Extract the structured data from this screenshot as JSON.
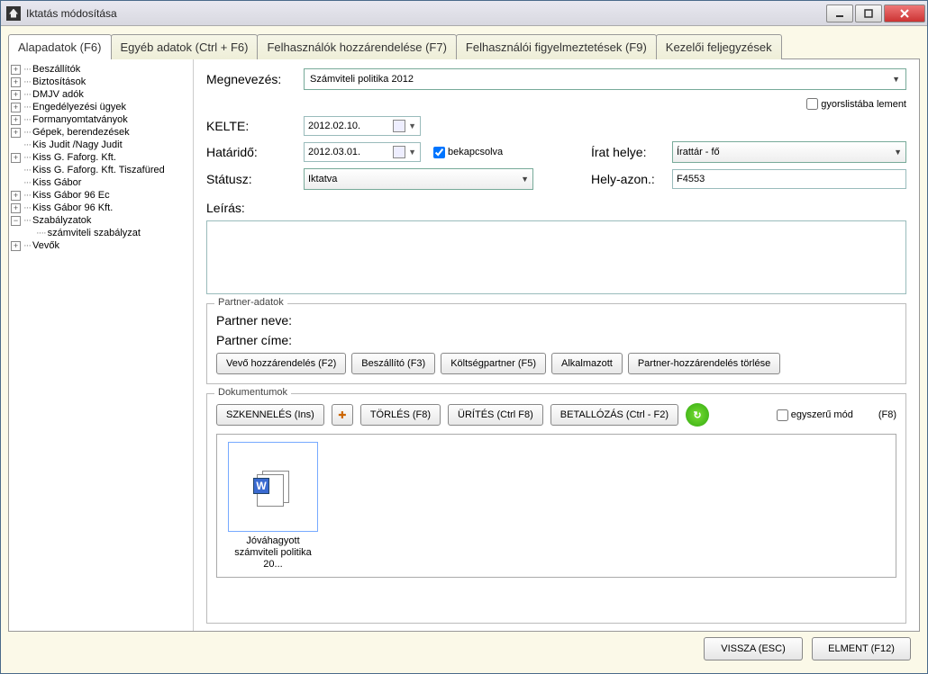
{
  "window": {
    "title": "Iktatás módosítása"
  },
  "tabs": [
    "Alapadatok (F6)",
    "Egyéb adatok (Ctrl + F6)",
    "Felhasználók hozzárendelése (F7)",
    "Felhasználói figyelmeztetések (F9)",
    "Kezelői feljegyzések"
  ],
  "tree": {
    "items": [
      {
        "label": "Beszállítók",
        "expandable": true
      },
      {
        "label": "Biztosítások",
        "expandable": true
      },
      {
        "label": "DMJV adók",
        "expandable": true
      },
      {
        "label": "Engedélyezési ügyek",
        "expandable": true
      },
      {
        "label": "Formanyomtatványok",
        "expandable": true
      },
      {
        "label": "Gépek, berendezések",
        "expandable": true
      },
      {
        "label": "Kis Judit /Nagy Judit",
        "expandable": false
      },
      {
        "label": "Kiss G. Faforg. Kft.",
        "expandable": true
      },
      {
        "label": "Kiss G. Faforg. Kft. Tiszafüred",
        "expandable": false
      },
      {
        "label": "Kiss Gábor",
        "expandable": false
      },
      {
        "label": "Kiss Gábor 96 Ec",
        "expandable": true
      },
      {
        "label": "Kiss Gábor 96 Kft.",
        "expandable": true
      },
      {
        "label": "Szabályzatok",
        "expandable": true,
        "expanded": true,
        "children": [
          {
            "label": "számviteli szabályzat"
          }
        ]
      },
      {
        "label": "Vevők",
        "expandable": true
      }
    ]
  },
  "form": {
    "megnevezes_label": "Megnevezés:",
    "megnevezes_value": "Számviteli politika 2012",
    "kelte_label": "KELTE:",
    "kelte_value": "2012.02.10.",
    "gyorslista_label": "gyorslistába lement",
    "hatarido_label": "Határidő:",
    "hatarido_value": "2012.03.01.",
    "bekapcsolva_label": "bekapcsolva",
    "irat_helye_label": "Írat helye:",
    "irat_helye_value": "Írattár - fő",
    "statusz_label": "Státusz:",
    "statusz_value": "Iktatva",
    "hely_azon_label": "Hely-azon.:",
    "hely_azon_value": "F4553",
    "leiras_label": "Leírás:"
  },
  "partner": {
    "legend": "Partner-adatok",
    "neve_label": "Partner neve:",
    "cime_label": "Partner címe:",
    "buttons": [
      "Vevő hozzárendelés (F2)",
      "Beszállító (F3)",
      "Költségpartner (F5)",
      "Alkalmazott",
      "Partner-hozzárendelés törlése"
    ]
  },
  "docs": {
    "legend": "Dokumentumok",
    "toolbar": {
      "scan": "SZKENNELÉS (Ins)",
      "delete": "TÖRLÉS (F8)",
      "empty": "ÜRÍTÉS (Ctrl F8)",
      "browse": "BETALLÓZÁS (Ctrl - F2)"
    },
    "simple_mode_label": "egyszerű mód",
    "f8": "(F8)",
    "thumb_caption_1": "Jóváhagyott",
    "thumb_caption_2": "számviteli politika 20..."
  },
  "footer": {
    "back": "VISSZA (ESC)",
    "save": "ELMENT (F12)"
  }
}
